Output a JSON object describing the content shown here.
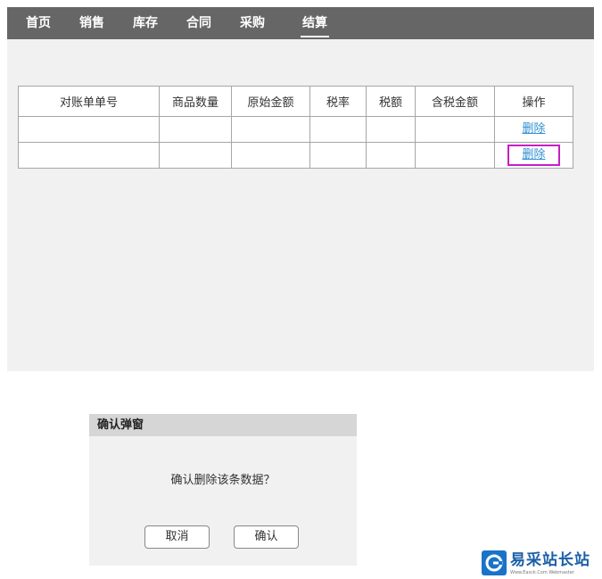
{
  "nav": {
    "items": [
      "首页",
      "销售",
      "库存",
      "合同",
      "采购",
      "结算"
    ],
    "active": "结算"
  },
  "table": {
    "headers": [
      "对账单单号",
      "商品数量",
      "原始金额",
      "税率",
      "税额",
      "含税金额",
      "操作"
    ],
    "rows": [
      {
        "cells": [
          "",
          "",
          "",
          "",
          "",
          ""
        ],
        "action": "删除"
      },
      {
        "cells": [
          "",
          "",
          "",
          "",
          "",
          ""
        ],
        "action": "删除"
      }
    ]
  },
  "dialog": {
    "title": "确认弹窗",
    "message": "确认删除该条数据？",
    "cancel_label": "取消",
    "confirm_label": "确认"
  },
  "watermark": {
    "text": "易采站长站",
    "subtext": "Www.Easck.Com Webmaster"
  },
  "colors": {
    "nav_bg": "#666666",
    "page_bg": "#f1f1f1",
    "link": "#2f8fd3",
    "highlight": "#c71ec7",
    "watermark": "#1a73c9"
  }
}
